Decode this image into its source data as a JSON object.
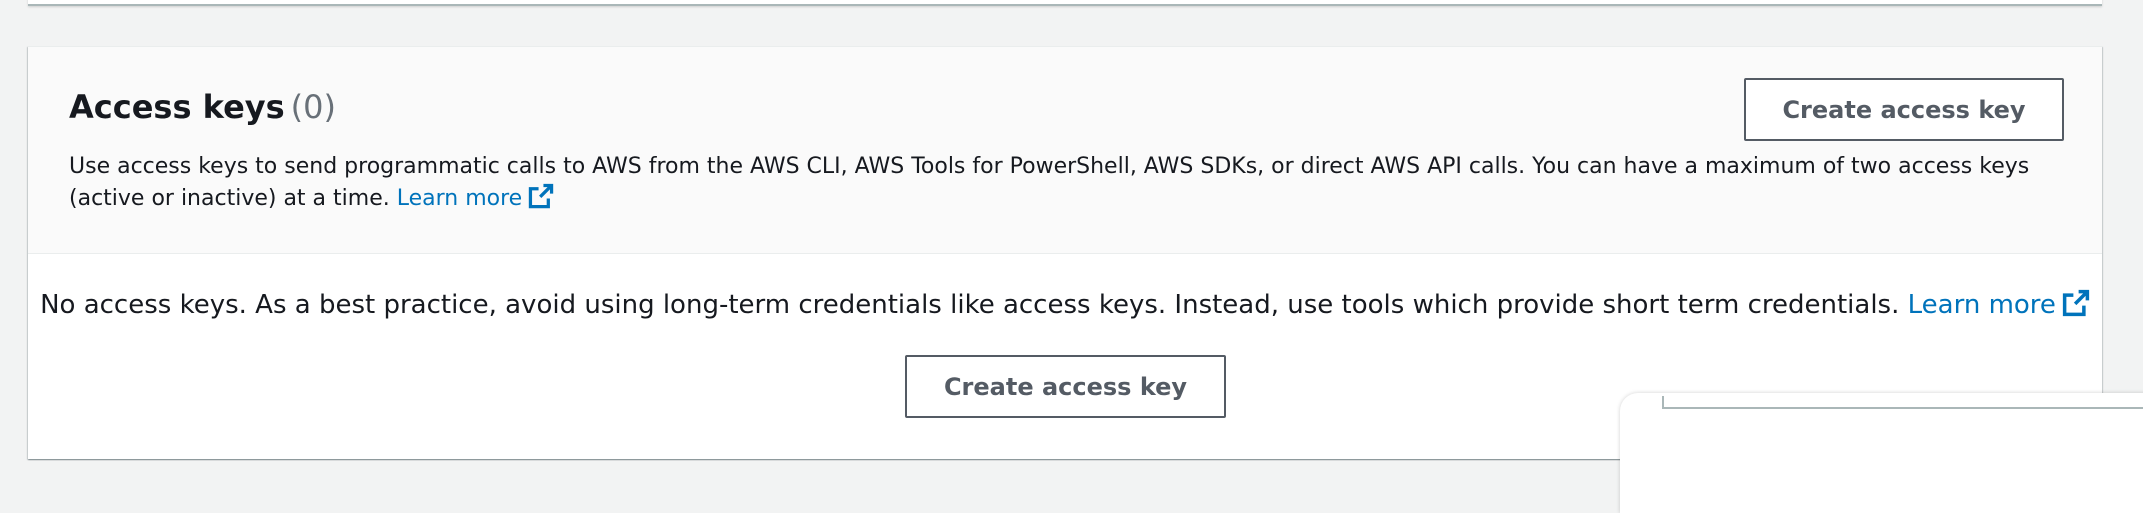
{
  "access_keys": {
    "title": "Access keys",
    "count": "(0)",
    "create_button_label": "Create access key",
    "description": "Use access keys to send programmatic calls to AWS from the AWS CLI, AWS Tools for PowerShell, AWS SDKs, or direct AWS API calls. You can have a maximum of two access keys (active or inactive) at a time.",
    "learn_more_label": "Learn more",
    "empty_state": {
      "message": "No access keys. As a best practice, avoid using long-term credentials like access keys. Instead, use tools which provide short term credentials.",
      "learn_more_label": "Learn more",
      "create_button_label": "Create access key"
    }
  },
  "icons": {
    "external_link": "external-link-icon"
  },
  "colors": {
    "link": "#0073bb",
    "button_border": "#545b64",
    "header_bg": "#fafafa",
    "page_bg": "#f2f3f3"
  }
}
